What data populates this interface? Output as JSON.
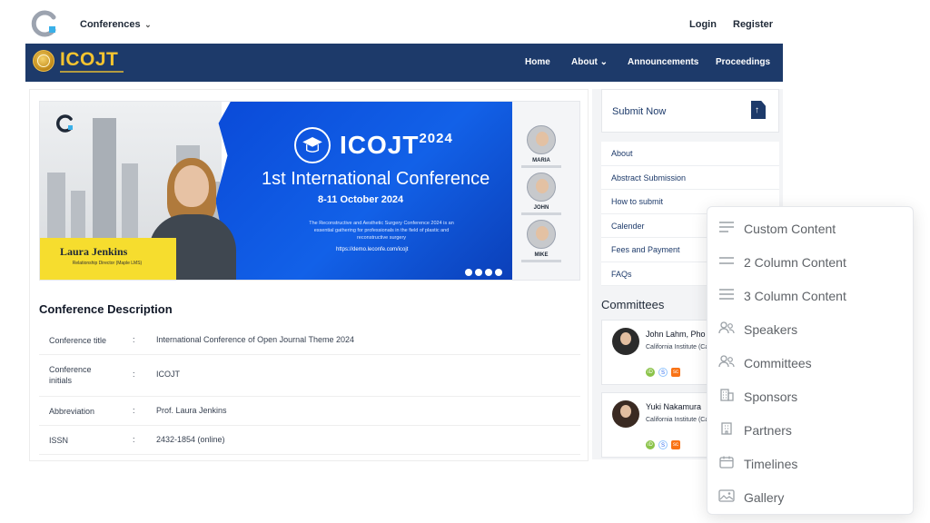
{
  "topbar": {
    "conferences_label": "Conferences",
    "login_label": "Login",
    "register_label": "Register"
  },
  "navbar": {
    "brand": "ICOJT",
    "items": [
      {
        "label": "Home"
      },
      {
        "label": "About ⌄"
      },
      {
        "label": "Announcements"
      },
      {
        "label": "Proceedings"
      }
    ]
  },
  "banner": {
    "person_name": "Laura Jenkins",
    "person_role": "Relationship Director (Maple LMS)",
    "title": "ICOJT",
    "title_year": "2024",
    "subtitle": "1st International Conference",
    "date": "8-11 October 2024",
    "description": "The Reconstructive and Aesthetic Surgery Conference 2024 is an essential gathering for professionals in the field of plastic and reconstructive surgery",
    "url": "https://demo.leconfe.com/icojt",
    "speakers": [
      {
        "name": "MARIA"
      },
      {
        "name": "JOHN"
      },
      {
        "name": "MIKE"
      }
    ]
  },
  "description": {
    "title": "Conference Description",
    "rows": [
      {
        "key": "Conference title",
        "sep": ":",
        "value": "International Conference of Open Journal Theme 2024"
      },
      {
        "key": "Conference initials",
        "sep": ":",
        "value": "ICOJT"
      },
      {
        "key": "Abbreviation",
        "sep": ":",
        "value": "Prof. Laura Jenkins"
      },
      {
        "key": "ISSN",
        "sep": ":",
        "value": "2432-1854 (online)"
      }
    ]
  },
  "sidebar": {
    "submit_label": "Submit Now",
    "links": [
      {
        "label": "About"
      },
      {
        "label": "Abstract Submission"
      },
      {
        "label": "How to submit"
      },
      {
        "label": "Calender"
      },
      {
        "label": "Fees and Payment"
      },
      {
        "label": "FAQs"
      }
    ],
    "committees_title": "Committees",
    "committees": [
      {
        "name": "John Lahm, Pho",
        "affiliation": "California Institute (Caltech)"
      },
      {
        "name": "Yuki Nakamura",
        "affiliation": "California Institute (Caltech)"
      }
    ]
  },
  "dropdown": {
    "items": [
      {
        "label": "Custom Content",
        "icon": "custom-content-icon"
      },
      {
        "label": "2 Column Content",
        "icon": "two-column-icon"
      },
      {
        "label": "3 Column Content",
        "icon": "three-column-icon"
      },
      {
        "label": "Speakers",
        "icon": "speakers-icon"
      },
      {
        "label": "Committees",
        "icon": "committees-icon"
      },
      {
        "label": "Sponsors",
        "icon": "sponsors-icon"
      },
      {
        "label": "Partners",
        "icon": "partners-icon"
      },
      {
        "label": "Timelines",
        "icon": "timelines-icon"
      },
      {
        "label": "Gallery",
        "icon": "gallery-icon"
      }
    ]
  },
  "colors": {
    "navy": "#1d3a6a",
    "gold": "#f4c430",
    "banner_blue": "#0a4ad8",
    "name_strip": "#f6dd2e"
  }
}
